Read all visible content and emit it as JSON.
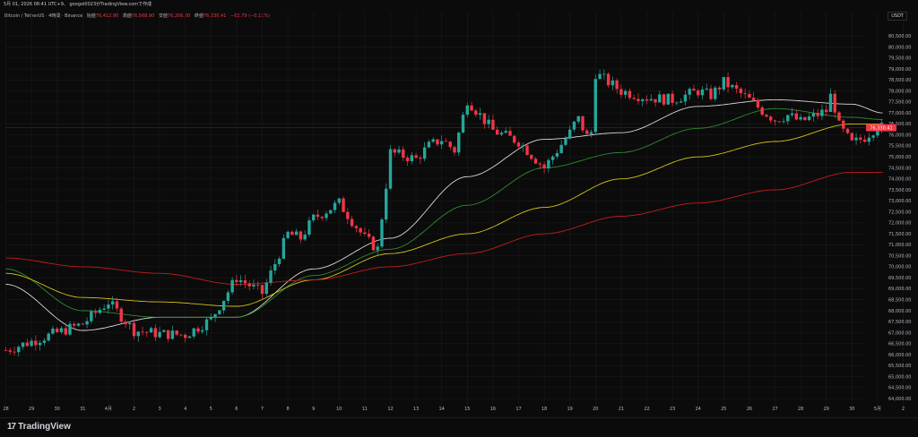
{
  "header": {
    "caption": "5月 01, 2026 08:41 UTC+9、 googol0023がTradingView.comで作成"
  },
  "legend": {
    "symbol": "Bitcoin / TetherUS · 4時間 · Binance",
    "open_label": "始値",
    "open_value": "76,412.90",
    "high_label": "高値",
    "high_value": "76,568.90",
    "low_label": "安値",
    "low_value": "76,206.00",
    "close_label": "終値",
    "close_value": "76,330.41",
    "change": "−82.79 (−0.11%)"
  },
  "currency_label": "USDT",
  "price_tag": "76,330.41",
  "branding": {
    "logo_text": "TradingView",
    "logo_mark": "17"
  },
  "colors": {
    "background": "#0b0b0b",
    "up": "#26a69a",
    "down": "#f23645",
    "ma_fast": "#d8d8d8",
    "ma_mid": "#2e8b2e",
    "ma_slow": "#d4c21a",
    "ma_long": "#c41c1c",
    "grid": "#1a1a1a"
  },
  "chart_data": {
    "type": "candlestick",
    "title": "",
    "y_axis_side": "right",
    "ylim": [
      63800,
      81000
    ],
    "y_ticks": [
      "64,000.00",
      "64,500.00",
      "65,000.00",
      "65,500.00",
      "66,000.00",
      "66,500.00",
      "67,000.00",
      "67,500.00",
      "68,000.00",
      "68,500.00",
      "69,000.00",
      "69,500.00",
      "70,000.00",
      "70,500.00",
      "71,000.00",
      "71,500.00",
      "72,000.00",
      "72,500.00",
      "73,000.00",
      "73,500.00",
      "74,000.00",
      "74,500.00",
      "75,000.00",
      "75,500.00",
      "76,000.00",
      "76,500.00",
      "77,000.00",
      "77,500.00",
      "78,000.00",
      "78,500.00",
      "79,000.00",
      "79,500.00",
      "80,000.00",
      "80,500.00"
    ],
    "x_ticks": [
      "28",
      "29",
      "30",
      "31",
      "4月",
      "2",
      "3",
      "4",
      "5",
      "6",
      "7",
      "8",
      "9",
      "10",
      "11",
      "12",
      "13",
      "14",
      "15",
      "16",
      "17",
      "18",
      "19",
      "20",
      "21",
      "22",
      "23",
      "24",
      "25",
      "26",
      "27",
      "28",
      "29",
      "30",
      "5月",
      "2"
    ],
    "x_ticks_days": [
      0,
      1,
      2,
      3,
      4,
      5,
      6,
      7,
      8,
      9,
      10,
      11,
      12,
      13,
      14,
      15,
      16,
      17,
      18,
      19,
      20,
      21,
      22,
      23,
      24,
      25,
      26,
      27,
      28,
      29,
      30,
      31,
      32,
      33,
      34,
      35
    ],
    "close_series_anchor_days": [
      0,
      1,
      2,
      3,
      4,
      5,
      6,
      7,
      8,
      9,
      10,
      11,
      11.5,
      12,
      13,
      14,
      14.5,
      15,
      16,
      16.5,
      17,
      17.5,
      18,
      19,
      20,
      21,
      22,
      22.3,
      22.8,
      23,
      24,
      25,
      26,
      27,
      27.5,
      28,
      29,
      29.5,
      30,
      30.5,
      31,
      32,
      32.2,
      32.5,
      33,
      33.5,
      34,
      34.2
    ],
    "close_series_anchor_values": [
      66200,
      66600,
      67000,
      67400,
      68400,
      67100,
      66950,
      66900,
      67600,
      69500,
      68800,
      71500,
      71300,
      72200,
      72900,
      71300,
      70800,
      75200,
      74900,
      75500,
      75800,
      75300,
      77600,
      76200,
      75700,
      74500,
      76100,
      76800,
      75600,
      78800,
      78000,
      77700,
      77600,
      78000,
      77800,
      78400,
      77600,
      77100,
      76700,
      76900,
      76600,
      77100,
      77900,
      76400,
      75600,
      75900,
      76400,
      76330
    ],
    "moving_averages": [
      {
        "key": "ma_fast",
        "anchor_days": [
          0,
          3,
          6,
          9,
          12,
          15,
          18,
          21,
          24,
          27,
          30,
          33,
          34.2
        ],
        "values": [
          69200,
          67100,
          67700,
          67700,
          69900,
          71300,
          74100,
          75800,
          76100,
          77300,
          77600,
          77400,
          77000
        ]
      },
      {
        "key": "ma_mid",
        "anchor_days": [
          0,
          3,
          6,
          9,
          12,
          15,
          18,
          21,
          24,
          27,
          30,
          33,
          34.2
        ],
        "values": [
          69900,
          68000,
          67700,
          67700,
          69600,
          70800,
          72800,
          74500,
          75200,
          76300,
          77200,
          76800,
          76700
        ]
      },
      {
        "key": "ma_slow",
        "anchor_days": [
          0,
          3,
          6,
          9,
          12,
          15,
          18,
          21,
          24,
          27,
          30,
          33,
          34.2
        ],
        "values": [
          69700,
          68600,
          68400,
          68200,
          69400,
          70600,
          71500,
          72700,
          74000,
          75000,
          75700,
          76500,
          76500
        ]
      },
      {
        "key": "ma_long",
        "anchor_days": [
          0,
          3,
          6,
          9,
          12,
          15,
          18,
          21,
          24,
          27,
          30,
          33,
          34.2
        ],
        "values": [
          70400,
          70000,
          69700,
          69200,
          69400,
          70000,
          70600,
          71500,
          72300,
          72900,
          73500,
          74300,
          74300
        ]
      }
    ],
    "current_price": 76330.41,
    "grid": true
  }
}
